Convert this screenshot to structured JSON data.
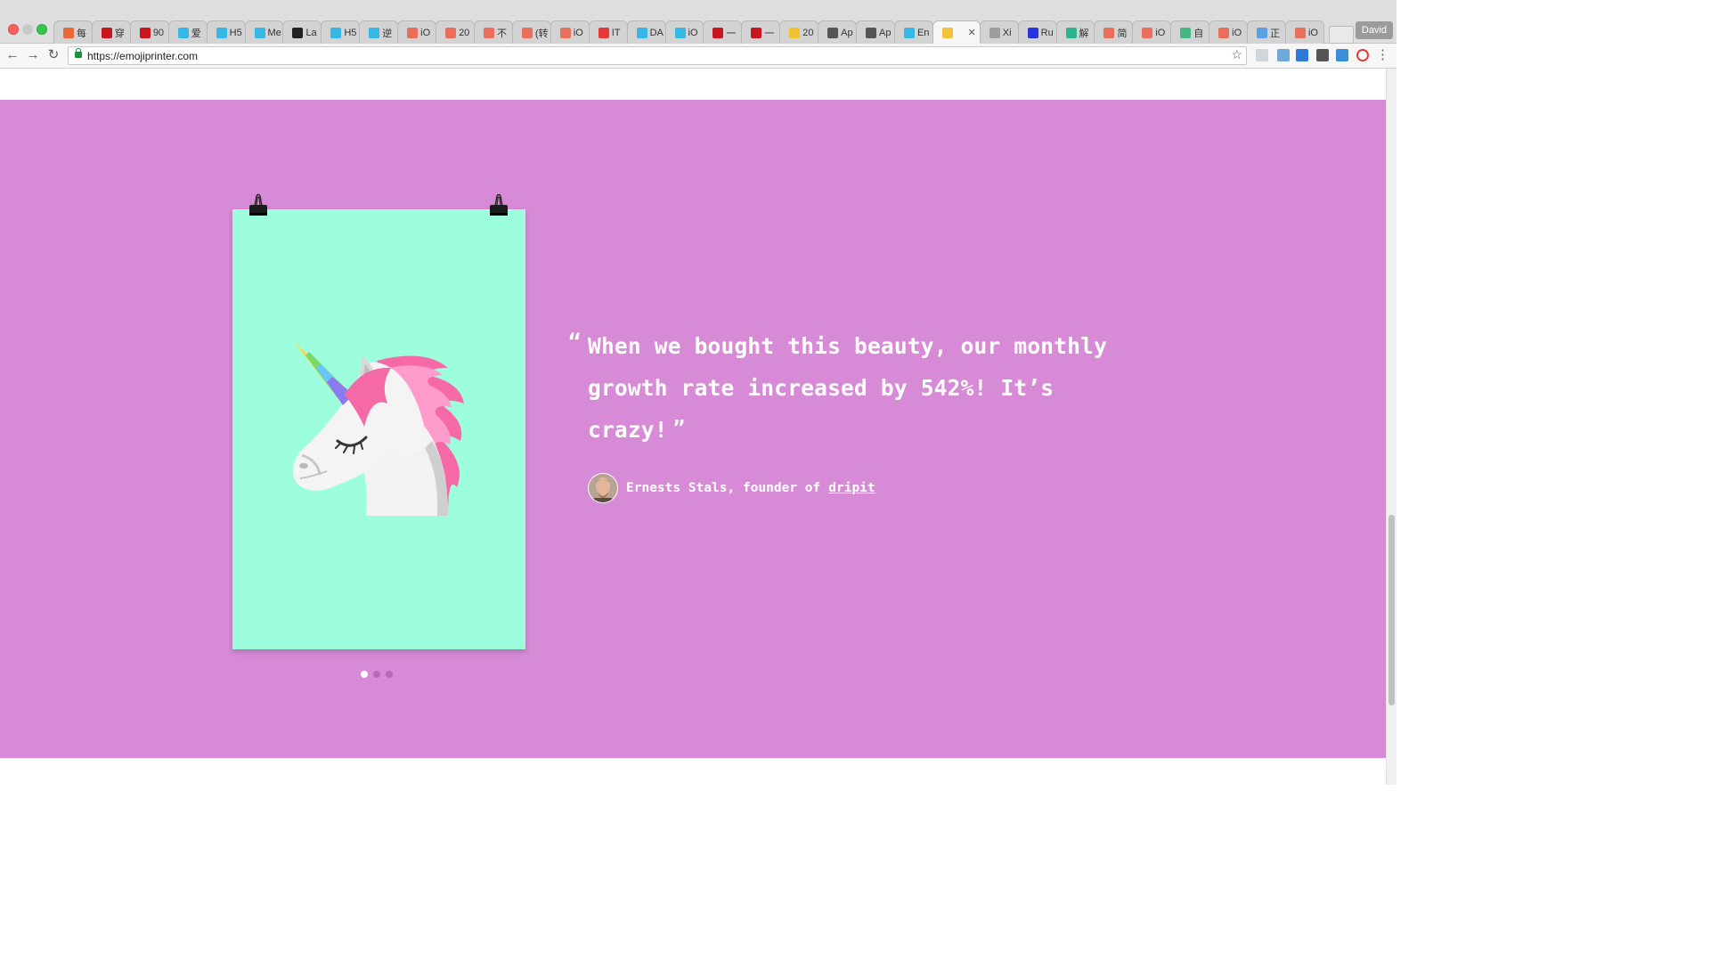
{
  "browser": {
    "tabs": [
      {
        "label": "每",
        "icon": "sougou-icon",
        "color": "#e8683a"
      },
      {
        "label": "穿",
        "icon": "jd-icon",
        "color": "#c9151e"
      },
      {
        "label": "90",
        "icon": "jd-icon",
        "color": "#c9151e"
      },
      {
        "label": "爱",
        "icon": "next-icon",
        "color": "#35b8e6"
      },
      {
        "label": "H5",
        "icon": "next-icon",
        "color": "#35b8e6"
      },
      {
        "label": "Me",
        "icon": "next-icon",
        "color": "#35b8e6"
      },
      {
        "label": "La",
        "icon": "square-icon",
        "color": "#222222"
      },
      {
        "label": "H5",
        "icon": "next-icon",
        "color": "#35b8e6"
      },
      {
        "label": "逆",
        "icon": "next-icon",
        "color": "#35b8e6"
      },
      {
        "label": "iO",
        "icon": "jianshu-icon",
        "color": "#ea6f5a"
      },
      {
        "label": "20",
        "icon": "jianshu-icon",
        "color": "#ea6f5a"
      },
      {
        "label": "不",
        "icon": "jianshu-icon",
        "color": "#ea6f5a"
      },
      {
        "label": "(转",
        "icon": "jianshu-icon",
        "color": "#ea6f5a"
      },
      {
        "label": "iO",
        "icon": "jianshu-icon",
        "color": "#ea6f5a"
      },
      {
        "label": "IT",
        "icon": "flame-icon",
        "color": "#e53935"
      },
      {
        "label": "DA",
        "icon": "next-icon",
        "color": "#35b8e6"
      },
      {
        "label": "iO",
        "icon": "next-icon",
        "color": "#35b8e6"
      },
      {
        "label": "一",
        "icon": "jd-icon",
        "color": "#c9151e"
      },
      {
        "label": "一",
        "icon": "jd-icon",
        "color": "#c9151e"
      },
      {
        "label": "20",
        "icon": "weather-icon",
        "color": "#f2c12e"
      },
      {
        "label": "Ap",
        "icon": "document-icon",
        "color": "#555555"
      },
      {
        "label": "Ap",
        "icon": "document-icon",
        "color": "#555555"
      },
      {
        "label": "En",
        "icon": "next-icon",
        "color": "#35b8e6"
      },
      {
        "label": "",
        "icon": "emoji-sunglasses-icon",
        "color": "#f5c33b",
        "active": true
      },
      {
        "label": "Xi",
        "icon": "grid-icon",
        "color": "#9e9e9e"
      },
      {
        "label": "Ru",
        "icon": "baidu-icon",
        "color": "#2932e1"
      },
      {
        "label": "解",
        "icon": "swift-icon",
        "color": "#2ab58f"
      },
      {
        "label": "简",
        "icon": "jianshu-icon",
        "color": "#ea6f5a"
      },
      {
        "label": "iO",
        "icon": "jianshu-icon",
        "color": "#ea6f5a"
      },
      {
        "label": "自",
        "icon": "vue-icon",
        "color": "#41b883"
      },
      {
        "label": "iO",
        "icon": "jianshu-icon",
        "color": "#ea6f5a"
      },
      {
        "label": "正",
        "icon": "bird-icon",
        "color": "#5aa0e6"
      },
      {
        "label": "iO",
        "icon": "jianshu-icon",
        "color": "#ea6f5a"
      }
    ],
    "close_glyph": "✕",
    "profile_name": "David",
    "url": "https://emojiprinter.com",
    "back_glyph": "←",
    "forward_glyph": "→",
    "reload_glyph": "↻",
    "star_glyph": "☆",
    "menu_glyph": "⋮"
  },
  "testimonial": {
    "quote": "When we bought this beauty, our monthly growth rate increased by 542%! It’s crazy!",
    "open_mark": "“",
    "close_mark": "”",
    "author": "Ernests Stals, founder of",
    "company": "dripit"
  },
  "carousel": {
    "slides": 3,
    "active_index": 0
  },
  "colors": {
    "hero_background": "#d78bd6",
    "poster_background": "#9dfedd"
  }
}
